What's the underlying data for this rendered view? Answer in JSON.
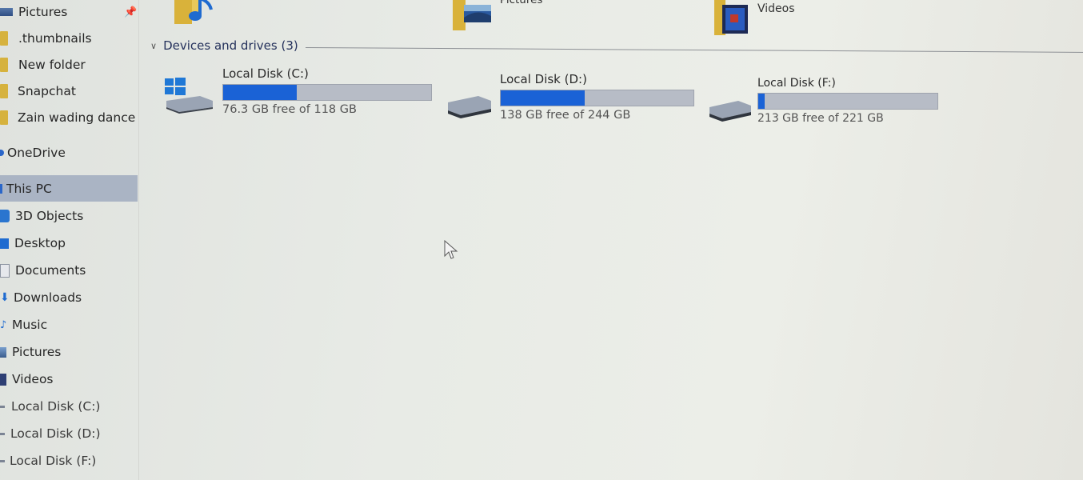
{
  "sidebar": {
    "quick_access": [
      {
        "label": "Pictures",
        "icon": "pictures-icon",
        "pinned": true
      },
      {
        "label": ".thumbnails",
        "icon": "folder-icon"
      },
      {
        "label": "New folder",
        "icon": "folder-icon"
      },
      {
        "label": "Snapchat",
        "icon": "folder-icon"
      },
      {
        "label": "Zain wading dance",
        "icon": "folder-icon"
      }
    ],
    "onedrive": {
      "label": "OneDrive",
      "icon": "onedrive-icon"
    },
    "this_pc": {
      "label": "This PC",
      "icon": "computer-icon",
      "selected": true
    },
    "pc_items": [
      {
        "label": "3D Objects",
        "icon": "3d-objects-icon"
      },
      {
        "label": "Desktop",
        "icon": "desktop-icon"
      },
      {
        "label": "Documents",
        "icon": "documents-icon"
      },
      {
        "label": "Downloads",
        "icon": "downloads-icon"
      },
      {
        "label": "Music",
        "icon": "music-icon"
      },
      {
        "label": "Pictures",
        "icon": "pictures-icon"
      },
      {
        "label": "Videos",
        "icon": "videos-icon"
      },
      {
        "label": "Local Disk (C:)",
        "icon": "drive-icon"
      },
      {
        "label": "Local Disk (D:)",
        "icon": "drive-icon"
      },
      {
        "label": "Local Disk (F:)",
        "icon": "drive-icon"
      }
    ]
  },
  "folders_row": [
    {
      "label": "",
      "icon": "music-folder-icon"
    },
    {
      "label": "Pictures",
      "icon": "pictures-folder-icon"
    },
    {
      "label": "Videos",
      "icon": "videos-folder-icon"
    }
  ],
  "devices": {
    "header": "Devices and drives (3)",
    "drives": [
      {
        "name": "Local Disk (C:)",
        "free_text": "76.3 GB free of 118 GB",
        "used_fraction": 0.353,
        "icon": "windows-drive-icon"
      },
      {
        "name": "Local Disk (D:)",
        "free_text": "138 GB free of 244 GB",
        "used_fraction": 0.434,
        "icon": "drive-icon"
      },
      {
        "name": "Local Disk (F:)",
        "free_text": "213 GB free of 221 GB",
        "used_fraction": 0.036,
        "icon": "drive-icon"
      }
    ]
  },
  "colors": {
    "accent": "#1a62d6",
    "bar_bg": "#b7bcc6",
    "selected": "#aab4c4"
  }
}
